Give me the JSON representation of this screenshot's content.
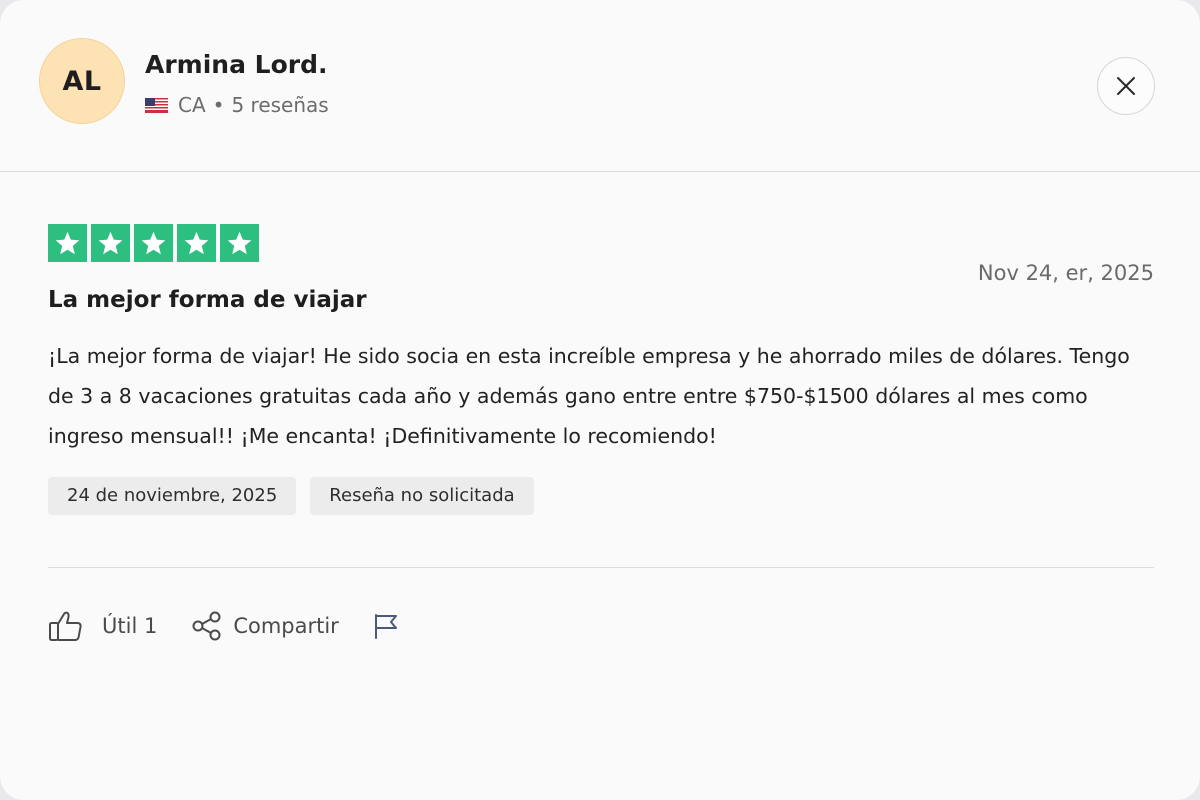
{
  "reviewer": {
    "initials": "AL",
    "name": "Armina Lord.",
    "country": "CA",
    "separator": "•",
    "review_count": "5 reseñas",
    "avatar_color": "#fde3b4"
  },
  "review": {
    "rating": 5,
    "star_color": "#2cbf7f",
    "date": "Nov 24, er, 2025",
    "title": "La mejor forma de viajar",
    "body": "¡La mejor forma de viajar! He sido socia en esta increíble empresa y he ahorrado miles de dólares. Tengo de 3 a 8 vacaciones gratuitas cada año y además gano entre entre $750-$1500 dólares al mes como ingreso mensual!! ¡Me encanta! ¡Definitivamente lo recomiendo!",
    "tags": [
      "24 de noviembre, 2025",
      "Reseña no solicitada"
    ]
  },
  "actions": {
    "useful_label": "Útil 1",
    "share_label": "Compartir"
  },
  "icons": {
    "flag": "us-flag-icon",
    "close": "close-icon",
    "like": "thumbs-up-icon",
    "share": "share-icon",
    "report": "report-flag-icon",
    "star": "star-icon"
  }
}
